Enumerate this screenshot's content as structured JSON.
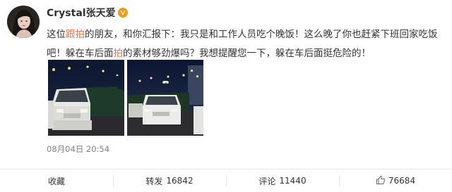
{
  "post": {
    "username": "Crystal张天爱",
    "verified_badge": "verified-v-icon",
    "text_parts": {
      "p1": "这位",
      "p2_highlight": "跟拍",
      "p3": "的朋友，和你汇报下：我只是和工作人员吃个晚饭！这么晚了你也赶紧下班回家吃饭吧！躲在车后面",
      "p4_highlight": "拍",
      "p5": "的素材够劲爆吗？我想提醒您一下，躲在车后面挺危险的！"
    },
    "highlight_color": "#eb7350",
    "photos": [
      {
        "name": "photo-1",
        "icon": "car-night-photo"
      },
      {
        "name": "photo-2",
        "icon": "car-night-photo"
      }
    ],
    "timestamp": "08月04日 20:54"
  },
  "actions": {
    "favorite_label": "收藏",
    "repost_label": "转发",
    "repost_count": "16842",
    "comment_label": "评论",
    "comment_count": "11440",
    "like_count": "76684",
    "like_icon": "thumbs-up-icon"
  }
}
